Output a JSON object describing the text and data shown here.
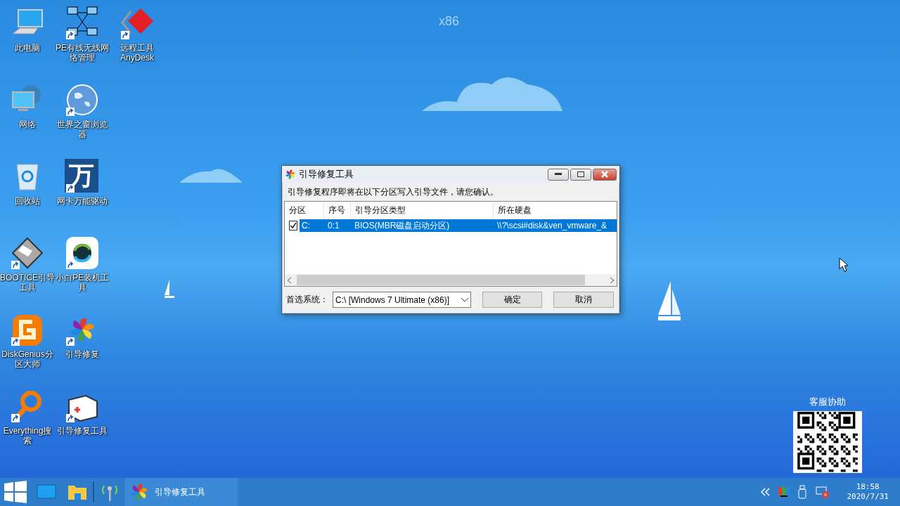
{
  "wallpaper_label": "x86",
  "desktop_icons": [
    {
      "label": "此电脑",
      "kind": "computer",
      "shortcut": false
    },
    {
      "label": "网络",
      "kind": "network",
      "shortcut": false
    },
    {
      "label": "回收站",
      "kind": "recycle",
      "shortcut": false
    },
    {
      "label": "BOOTICE引导工具",
      "kind": "floppy",
      "shortcut": true
    },
    {
      "label": "DiskGenius分区大师",
      "kind": "disk",
      "shortcut": true
    },
    {
      "label": "Everything搜索",
      "kind": "magnifier",
      "shortcut": true
    },
    {
      "label": "PE有线无线网络管理",
      "kind": "topology",
      "shortcut": true
    },
    {
      "label": "世界之窗浏览器",
      "kind": "globe",
      "shortcut": true
    },
    {
      "label": "网卡万能驱动",
      "kind": "glyph",
      "glyph": "万",
      "shortcut": true
    },
    {
      "label": "小白PE装机工具",
      "kind": "sync",
      "shortcut": true
    },
    {
      "label": "引导修复",
      "kind": "pinwheel",
      "shortcut": true
    },
    {
      "label": "引导修复工具",
      "kind": "toolbox",
      "shortcut": true
    },
    {
      "label": "远程工具 AnyDesk",
      "kind": "diamond",
      "shortcut": true
    }
  ],
  "dialog": {
    "title": "引导修复工具",
    "message": "引导修复程序即将在以下分区写入引导文件，请您确认。",
    "columns": [
      "分区",
      "序号",
      "引导分区类型",
      "所在硬盘"
    ],
    "rows": [
      {
        "cells": [
          "C:",
          "0:1",
          "BIOS(MBR磁盘启动分区)",
          "\\\\?\\scsi#disk&ven_vmware_&"
        ],
        "checked": true,
        "selected": true
      }
    ],
    "preferred_label": "首选系统：",
    "preferred_value": "C:\\ [Windows 7 Ultimate (x86)]",
    "buttons": [
      "确定",
      "取消"
    ]
  },
  "support": {
    "label": "客服协助"
  },
  "taskbar": {
    "tasks": [
      {
        "label": "引导修复工具",
        "selected": true
      }
    ],
    "time": "18:58",
    "date": "2020/7/31"
  }
}
